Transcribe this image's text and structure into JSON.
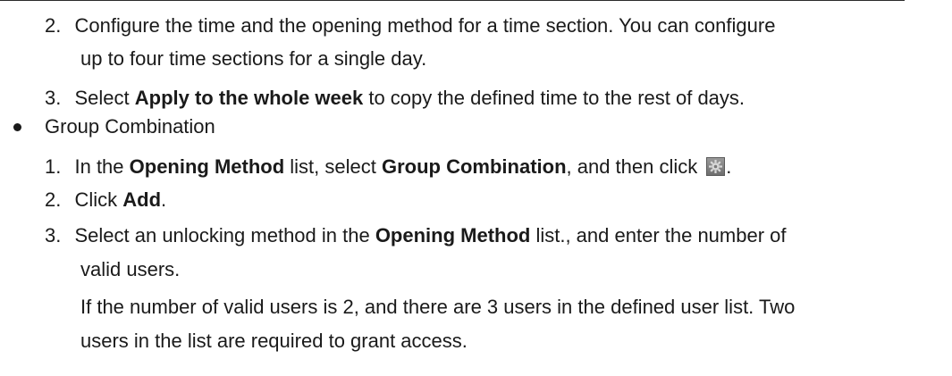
{
  "lines": {
    "l1": {
      "num": "2.",
      "text": "Configure the time and the opening method for a time section. You can configure"
    },
    "l1b": {
      "text": "up to four time sections for a single day."
    },
    "l2": {
      "num": "3.",
      "pre": "Select ",
      "bold": "Apply to the whole week",
      "post": " to copy the defined time to the rest of days."
    },
    "bullet": {
      "text": "Group Combination"
    },
    "g1": {
      "num": "1.",
      "pre": "In the ",
      "bold1": "Opening Method",
      "mid": " list, select ",
      "bold2": "Group Combination",
      "post": ", and then click",
      "end": "."
    },
    "g2": {
      "num": "2.",
      "pre": "Click ",
      "bold": "Add",
      "post": "."
    },
    "g3": {
      "num": "3.",
      "pre": "Select an unlocking method in the ",
      "bold": "Opening Method",
      "post": " list., and enter the number of"
    },
    "g3b": {
      "text": "valid users."
    },
    "note1": {
      "text": "If the number of valid users is 2, and there are 3 users in the defined user list. Two"
    },
    "note2": {
      "text": "users in the list are required to grant access."
    }
  },
  "icons": {
    "settings": "gear-icon"
  }
}
